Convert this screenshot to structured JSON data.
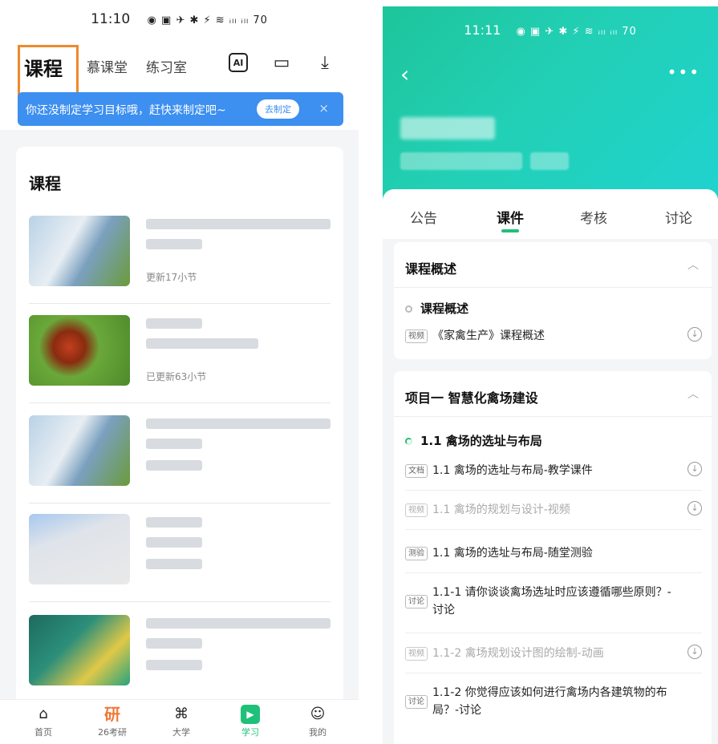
{
  "left": {
    "status": {
      "time": "11:10",
      "icons": "◉ ▣ ✈ ✱ ⚡ ≋ ᵢₗₗ ᵢₗₗ 70"
    },
    "nav": {
      "active_tab": "课程",
      "tabs": [
        "慕课堂",
        "练习室"
      ],
      "icons": [
        "ai-icon",
        "calendar-icon",
        "download-icon"
      ],
      "ai_label": "AI"
    },
    "goal_banner": {
      "text": "你还没制定学习目标哦，赶快来制定吧~",
      "button": "去制定",
      "close": "×"
    },
    "card_title": "课程",
    "courses": [
      {
        "title_blur": true,
        "update": "更新17小节",
        "price": ""
      },
      {
        "title_blur": true,
        "update": "已更新63小节",
        "price": ""
      },
      {
        "title_blur": true,
        "update": "",
        "price": ""
      },
      {
        "title_blur": true,
        "update": "",
        "price": ""
      },
      {
        "title_blur": true,
        "update": "",
        "price": ""
      }
    ],
    "bottom_nav": [
      {
        "label": "首页",
        "icon": "home-icon"
      },
      {
        "label": "26考研",
        "icon": "yan-icon",
        "glyph": "研"
      },
      {
        "label": "大学",
        "icon": "graduation-cap-icon"
      },
      {
        "label": "学习",
        "icon": "play-icon"
      },
      {
        "label": "我的",
        "icon": "smile-icon"
      }
    ]
  },
  "right": {
    "status": {
      "time": "11:11",
      "icons": "◉ ▣ ✈ ✱ ⚡ ≋ ᵢₗₗ ᵢₗₗ 70"
    },
    "tabs": [
      "公告",
      "课件",
      "考核",
      "讨论"
    ],
    "active_tab_index": 1,
    "sections": [
      {
        "title": "课程概述",
        "chapters": [
          {
            "title": "课程概述",
            "items": [
              {
                "tag": "视频",
                "text": "《家禽生产》课程概述",
                "download": true,
                "dim": false
              }
            ]
          }
        ]
      },
      {
        "title": "项目一 智慧化禽场建设",
        "chapters": [
          {
            "title": "1.1 禽场的选址与布局",
            "items": [
              {
                "tag": "文档",
                "text": "1.1 禽场的选址与布局-教学课件",
                "download": true,
                "dim": false
              },
              {
                "tag": "视频",
                "text": "1.1 禽场的规划与设计-视频",
                "download": true,
                "dim": true
              },
              {
                "tag": "测验",
                "text": "1.1 禽场的选址与布局-随堂测验",
                "download": false,
                "dim": false
              },
              {
                "tag": "讨论",
                "text": "1.1-1 请你谈谈禽场选址时应该遵循哪些原则？-讨论",
                "download": false,
                "dim": false
              },
              {
                "tag": "视频",
                "text": "1.1-2 禽场规划设计图的绘制-动画",
                "download": true,
                "dim": true
              },
              {
                "tag": "讨论",
                "text": "1.1-2 你觉得应该如何进行禽场内各建筑物的布局？-讨论",
                "download": false,
                "dim": false
              }
            ]
          }
        ]
      }
    ]
  },
  "colors": {
    "accent_green": "#1fc07a",
    "banner_blue": "#3d8ff0",
    "highlight_orange": "#ee8a2c"
  }
}
